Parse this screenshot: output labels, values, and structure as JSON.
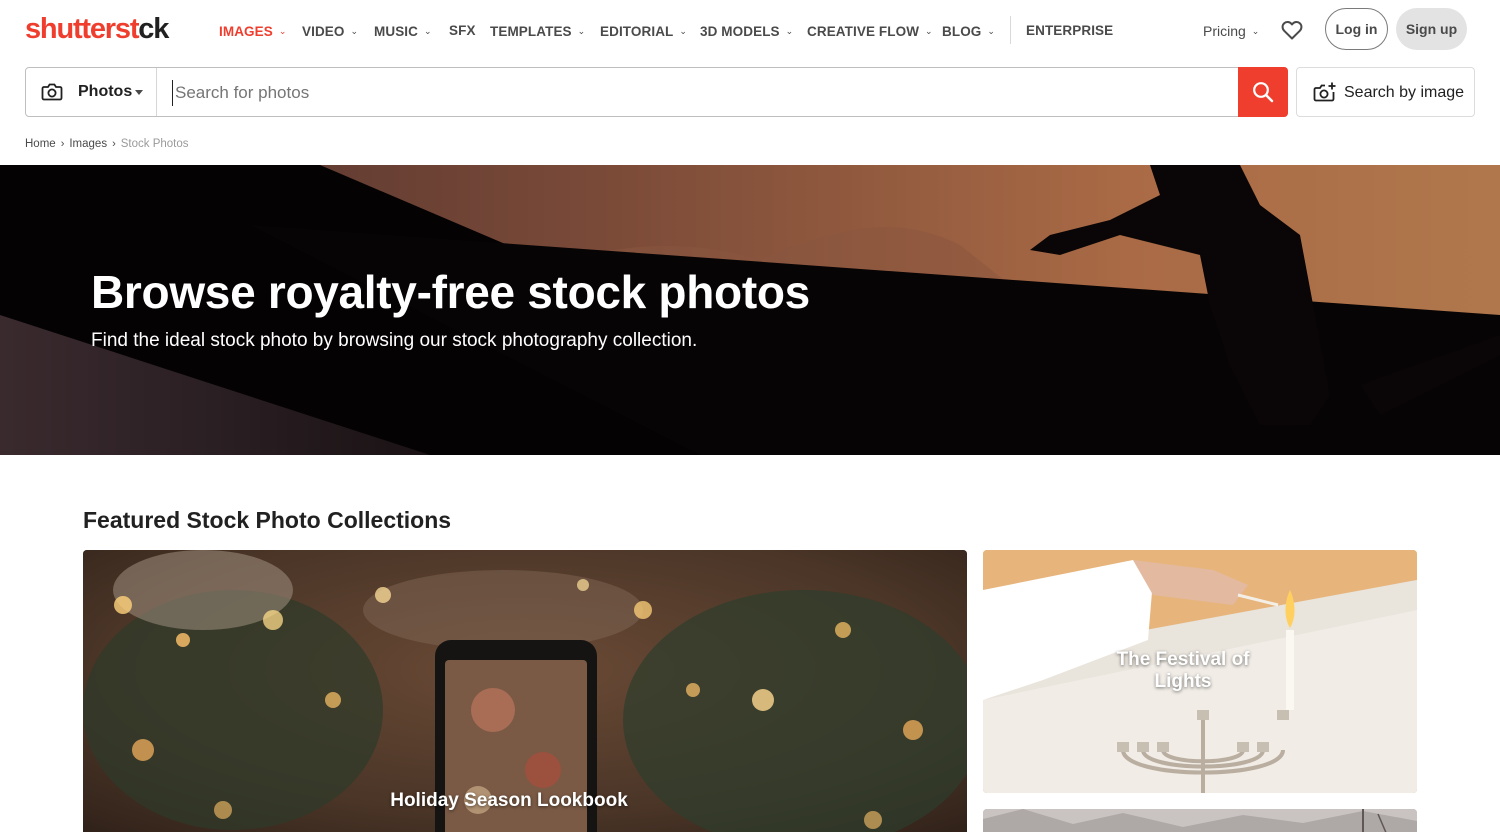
{
  "logo": {
    "part1": "shutterst",
    "part2": "ck"
  },
  "nav": {
    "items": [
      {
        "label": "IMAGES",
        "chevron": true,
        "active": true
      },
      {
        "label": "VIDEO",
        "chevron": true
      },
      {
        "label": "MUSIC",
        "chevron": true
      },
      {
        "label": "SFX",
        "chevron": false
      },
      {
        "label": "TEMPLATES",
        "chevron": true
      },
      {
        "label": "EDITORIAL",
        "chevron": true
      },
      {
        "label": "3D MODELS",
        "chevron": true
      },
      {
        "label": "CREATIVE FLOW",
        "chevron": true
      },
      {
        "label": "BLOG",
        "chevron": true
      },
      {
        "label": "ENTERPRISE",
        "chevron": false
      }
    ],
    "pricing": "Pricing",
    "login": "Log in",
    "signup": "Sign up",
    "icons": {
      "favorites": "heart-icon",
      "chevron": "chevron-down-icon"
    }
  },
  "search": {
    "type_label": "Photos",
    "placeholder": "Search for photos",
    "value": "",
    "by_image_label": "Search by image",
    "icons": {
      "type": "camera-icon",
      "submit": "search-icon",
      "by_image": "camera-plus-icon"
    }
  },
  "breadcrumb": {
    "items": [
      "Home",
      "Images",
      "Stock Photos"
    ]
  },
  "hero": {
    "title": "Browse royalty-free stock photos",
    "subtitle": "Find the ideal stock photo by browsing our stock photography collection."
  },
  "featured": {
    "title": "Featured Stock Photo Collections",
    "cards": [
      {
        "label": "Holiday Season Lookbook"
      },
      {
        "label": "The Festival of Lights"
      },
      {
        "label": ""
      }
    ]
  },
  "colors": {
    "brand": "#ef3e2e",
    "text": "#212121",
    "muted": "#757575",
    "hero_bg": "#0a0506"
  }
}
